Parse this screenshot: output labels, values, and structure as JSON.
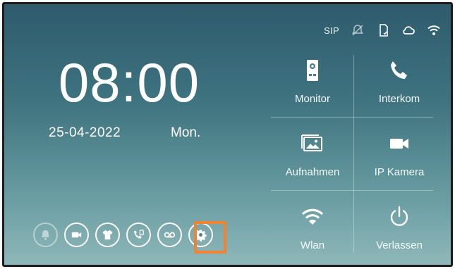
{
  "status": {
    "sip": "SIP",
    "icons": [
      "bell-muted-icon",
      "sd-card-icon",
      "cloud-icon",
      "wifi-icon"
    ]
  },
  "clock": {
    "time": "08:00",
    "date": "25-04-2022",
    "day": "Mon."
  },
  "quick_actions": [
    {
      "name": "do-not-disturb-icon",
      "active": false
    },
    {
      "name": "video-icon",
      "active": true
    },
    {
      "name": "shirt-icon",
      "active": true
    },
    {
      "name": "phone-transfer-icon",
      "active": true
    },
    {
      "name": "voicemail-icon",
      "active": true
    },
    {
      "name": "settings-gear-icon",
      "active": true,
      "selected": true
    }
  ],
  "tiles": {
    "monitor": "Monitor",
    "interkom": "Interkom",
    "aufnahmen": "Aufnahmen",
    "ip_kamera": "IP Kamera",
    "wlan": "Wlan",
    "verlassen": "Verlassen"
  },
  "colors": {
    "highlight": "#f2822d",
    "background_top": "#2e5b6d",
    "background_bottom": "#8fb7b9"
  }
}
